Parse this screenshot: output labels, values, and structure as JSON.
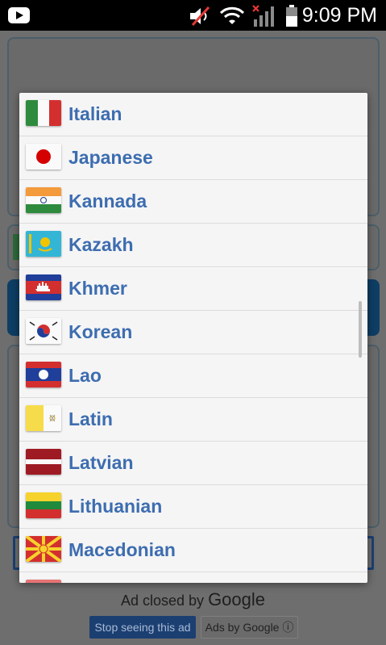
{
  "status_bar": {
    "time": "9:09 PM"
  },
  "background_ad": {
    "closed_text": "Ad closed by",
    "brand": "Google",
    "stop_button": "Stop seeing this ad",
    "ads_by_button": "Ads by Google ⓘ"
  },
  "language_list": {
    "items": [
      {
        "label": "Italian",
        "flag": "italy-flag"
      },
      {
        "label": "Japanese",
        "flag": "japan-flag"
      },
      {
        "label": "Kannada",
        "flag": "india-flag"
      },
      {
        "label": "Kazakh",
        "flag": "kazakhstan-flag"
      },
      {
        "label": "Khmer",
        "flag": "cambodia-flag"
      },
      {
        "label": "Korean",
        "flag": "south-korea-flag"
      },
      {
        "label": "Lao",
        "flag": "laos-flag"
      },
      {
        "label": "Latin",
        "flag": "vatican-flag"
      },
      {
        "label": "Latvian",
        "flag": "latvia-flag"
      },
      {
        "label": "Lithuanian",
        "flag": "lithuania-flag"
      },
      {
        "label": "Macedonian",
        "flag": "macedonia-flag"
      },
      {
        "label": "",
        "flag": "partial-flag"
      }
    ]
  },
  "colors": {
    "label": "#3d6db0",
    "dialog_bg": "#f5f5f5"
  }
}
